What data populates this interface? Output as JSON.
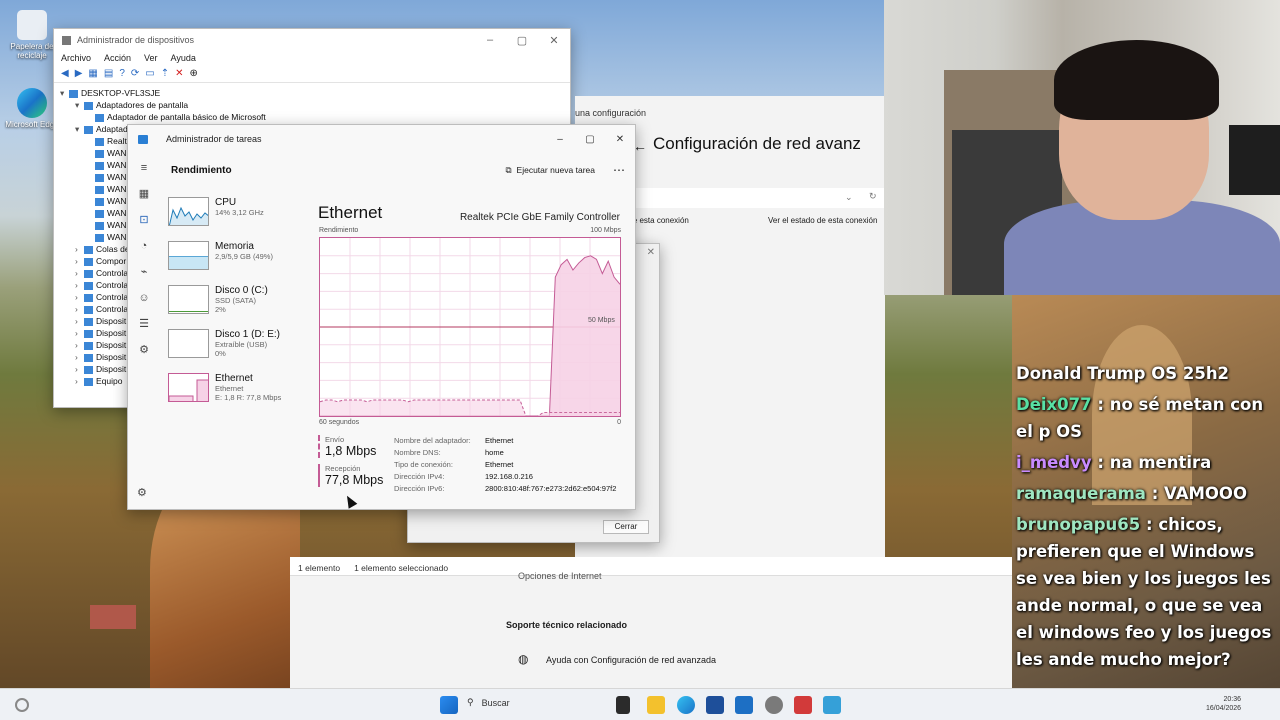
{
  "desktop": {
    "icons": [
      {
        "label": "Papelera de reciclaje",
        "icon": "recycle-bin-icon"
      },
      {
        "label": "Microsoft Edge",
        "icon": "edge-icon"
      }
    ]
  },
  "device_manager": {
    "title": "Administrador de dispositivos",
    "menu": [
      "Archivo",
      "Acción",
      "Ver",
      "Ayuda"
    ],
    "tree": [
      {
        "label": "DESKTOP-VFL3SJE",
        "level": 0
      },
      {
        "label": "Adaptadores de pantalla",
        "level": 1
      },
      {
        "label": "Adaptador de pantalla básico de Microsoft",
        "level": 2
      },
      {
        "label": "Adaptad",
        "level": 1
      },
      {
        "label": "Realt",
        "level": 2
      },
      {
        "label": "WAN",
        "level": 2
      },
      {
        "label": "WAN",
        "level": 2
      },
      {
        "label": "WAN",
        "level": 2
      },
      {
        "label": "WAN",
        "level": 2
      },
      {
        "label": "WAN",
        "level": 2
      },
      {
        "label": "WAN",
        "level": 2
      },
      {
        "label": "WAN",
        "level": 2
      },
      {
        "label": "WAN",
        "level": 2
      },
      {
        "label": "Colas de",
        "level": 1
      },
      {
        "label": "Compor",
        "level": 1
      },
      {
        "label": "Controla",
        "level": 1
      },
      {
        "label": "Controla",
        "level": 1
      },
      {
        "label": "Controla",
        "level": 1
      },
      {
        "label": "Controla",
        "level": 1
      },
      {
        "label": "Disposit",
        "level": 1
      },
      {
        "label": "Disposit",
        "level": 1
      },
      {
        "label": "Disposit",
        "level": 1
      },
      {
        "label": "Disposit",
        "level": 1
      },
      {
        "label": "Disposit",
        "level": 1
      },
      {
        "label": "Equipo",
        "level": 1
      }
    ]
  },
  "settings": {
    "crumb": "una configuración",
    "title": "Configuración de red avanz",
    "link_rename": "biar el nombre de esta conexión",
    "link_status": "Ver el estado de esta conexión",
    "internet_options": "Opciones de Internet",
    "support_heading": "Soporte técnico relacionado",
    "support_link": "Ayuda con Configuración de red avanzada"
  },
  "explorer_status": {
    "count": "1 elemento",
    "selected": "1 elemento seleccionado"
  },
  "net_dialog": {
    "close_button": "Cerrar"
  },
  "task_manager": {
    "title": "Administrador de tareas",
    "section": "Rendimiento",
    "run_task": "Ejecutar nueva tarea",
    "resources": [
      {
        "name": "CPU",
        "sub1": "14% 3,12 GHz",
        "sub2": ""
      },
      {
        "name": "Memoria",
        "sub1": "2,9/5,9 GB (49%)",
        "sub2": ""
      },
      {
        "name": "Disco 0 (C:)",
        "sub1": "SSD (SATA)",
        "sub2": "2%"
      },
      {
        "name": "Disco 1 (D: E:)",
        "sub1": "Extraíble (USB)",
        "sub2": "0%"
      },
      {
        "name": "Ethernet",
        "sub1": "Ethernet",
        "sub2": "E: 1,8 R: 77,8 Mbps"
      }
    ],
    "detail": {
      "name": "Ethernet",
      "adapter": "Realtek PCIe GbE Family Controller",
      "graph_label": "Rendimiento",
      "graph_max": "100 Mbps",
      "graph_mid": "50 Mbps",
      "graph_time": "60 segundos",
      "graph_zero": "0",
      "send_label": "Envío",
      "send_value": "1,8 Mbps",
      "recv_label": "Recepción",
      "recv_value": "77,8 Mbps",
      "properties": [
        {
          "k": "Nombre del adaptador:",
          "v": "Ethernet"
        },
        {
          "k": "Nombre DNS:",
          "v": "home"
        },
        {
          "k": "Tipo de conexión:",
          "v": "Ethernet"
        },
        {
          "k": "Dirección IPv4:",
          "v": "192.168.0.216"
        },
        {
          "k": "Dirección IPv6:",
          "v": "2800:810:48f:767:e273:2d62:e504:97f2"
        }
      ]
    },
    "receive_series": [
      0,
      0,
      0,
      0,
      0,
      0,
      0,
      0,
      0,
      0,
      0,
      0,
      0,
      0,
      0,
      0,
      0,
      0,
      0,
      0,
      0,
      0,
      0,
      0,
      0,
      0,
      0,
      0,
      0,
      0,
      0,
      0,
      0,
      0,
      0,
      0,
      0,
      0,
      0,
      0,
      78,
      85,
      88,
      82,
      86,
      89,
      90,
      88,
      80,
      87,
      78,
      74
    ],
    "send_series": [
      8,
      9,
      9,
      8,
      9,
      9,
      9,
      9,
      8,
      9,
      9,
      9,
      9,
      9,
      9,
      8,
      9,
      9,
      9,
      9,
      9,
      9,
      9,
      9,
      9,
      9,
      9,
      9,
      9,
      9,
      9,
      9,
      9,
      9,
      9,
      0,
      0,
      0,
      2,
      2,
      2,
      2,
      2,
      2,
      2,
      2,
      2,
      2,
      2,
      2,
      2,
      2
    ],
    "colors": {
      "accent": "#c45b95",
      "fill": "#f6d2e6"
    }
  },
  "chat": [
    {
      "user": "",
      "text": "Donald Trump OS 25h2",
      "color": "#ffffff"
    },
    {
      "user": "Deix077",
      "text": ": no sé metan con el p OS",
      "color": "#58e0a4"
    },
    {
      "user": "i_medvy",
      "text": ": na mentira",
      "color": "#c98bff"
    },
    {
      "user": "ramaquerama",
      "text": ": VAMOOO",
      "color": "#9fe6c1"
    },
    {
      "user": "brunopapu65",
      "text": ": chicos, prefieren que el Windows se vea bien y los juegos les ande normal, o que se vea el windows feo y los juegos les ande mucho mejor?",
      "color": "#9fe6c1"
    }
  ],
  "taskbar": {
    "search_placeholder": "Buscar",
    "time": "20:36",
    "date": "16/04/2026"
  }
}
